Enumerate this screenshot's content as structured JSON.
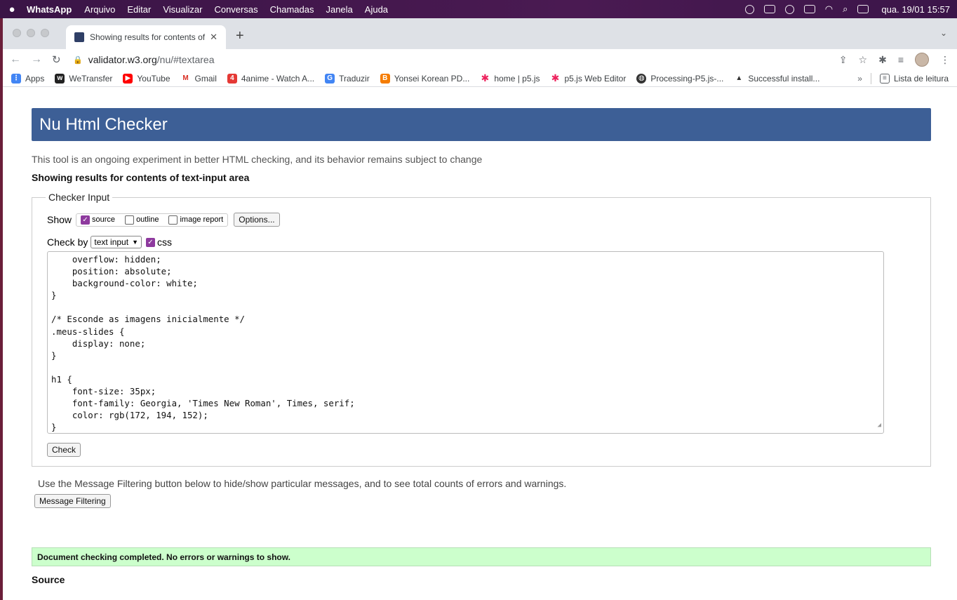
{
  "menubar": {
    "app": "WhatsApp",
    "items": [
      "Arquivo",
      "Editar",
      "Visualizar",
      "Conversas",
      "Chamadas",
      "Janela",
      "Ajuda"
    ],
    "clock": "qua. 19/01  15:57"
  },
  "browser": {
    "tab_title": "Showing results for contents of",
    "url_host": "validator.w3.org",
    "url_path": "/nu/#textarea",
    "bookmarks": [
      "Apps",
      "WeTransfer",
      "YouTube",
      "Gmail",
      "4anime - Watch A...",
      "Traduzir",
      "Yonsei Korean PD...",
      "home | p5.js",
      "p5.js Web Editor",
      "Processing-P5.js-...",
      "Successful install..."
    ],
    "overflow": "»",
    "reading_list": "Lista de leitura"
  },
  "page": {
    "title": "Nu Html Checker",
    "intro": "This tool is an ongoing experiment in better HTML checking, and its behavior remains subject to change",
    "showing": "Showing results for contents of text-input area",
    "checker_legend": "Checker Input",
    "show_label": "Show",
    "show_options": [
      "source",
      "outline",
      "image report"
    ],
    "options_button": "Options...",
    "check_by_label": "Check by",
    "check_by_value": "text input",
    "css_label": "css",
    "code": "    overflow: hidden;\n    position: absolute;\n    background-color: white;\n}\n\n/* Esconde as imagens inicialmente */\n.meus-slides {\n    display: none;\n}\n\nh1 {\n    font-size: 35px;\n    font-family: Georgia, 'Times New Roman', Times, serif;\n    color: rgb(172, 194, 152);\n}",
    "check_button": "Check",
    "filter_text": "Use the Message Filtering button below to hide/show particular messages, and to see total counts of errors and warnings.",
    "filter_button": "Message Filtering",
    "success": "Document checking completed. No errors or warnings to show.",
    "source_heading": "Source"
  }
}
